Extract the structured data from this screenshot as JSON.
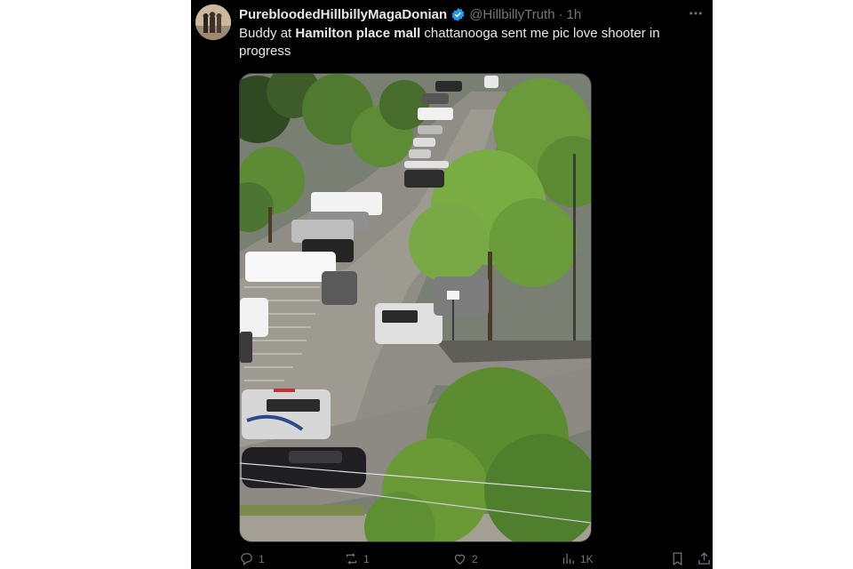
{
  "tweet": {
    "author": {
      "display_name": "PurebloodedHillbillyMagaDonian",
      "handle": "@HillbillyTruth",
      "verified": true
    },
    "time": "1h",
    "more_icon": "more-dots-icon",
    "text_parts": {
      "before": "Buddy at ",
      "bold": "Hamilton place mall",
      "after": " chattanooga sent me pic love shooter in progress"
    },
    "media": {
      "alt_description_shown": false
    },
    "actions": {
      "reply": {
        "icon": "reply-icon",
        "count": "1"
      },
      "retweet": {
        "icon": "retweet-icon",
        "count": "1"
      },
      "like": {
        "icon": "heart-icon",
        "count": "2"
      },
      "views": {
        "icon": "analytics-icon",
        "count": "1K"
      },
      "bookmark": {
        "icon": "bookmark-icon"
      },
      "share": {
        "icon": "share-icon"
      }
    }
  },
  "colors": {
    "background": "#000000",
    "text": "#e7e9ea",
    "secondary": "#71767b",
    "verified": "#1d9bf0"
  }
}
